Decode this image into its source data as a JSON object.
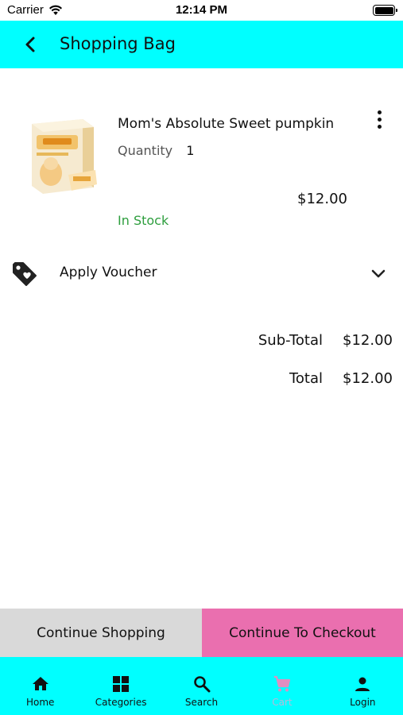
{
  "status_bar": {
    "carrier": "Carrier",
    "time": "12:14 PM"
  },
  "header": {
    "title": "Shopping Bag"
  },
  "cart_item": {
    "name": "Mom's Absolute Sweet pumpkin",
    "quantity_label": "Quantity",
    "quantity": "1",
    "price": "$12.00",
    "stock_status": "In Stock",
    "image_icon": "product-box-image"
  },
  "voucher": {
    "label": "Apply Voucher",
    "icon": "tag-icon",
    "chevron": "chevron-down-icon"
  },
  "totals": {
    "subtotal_label": "Sub-Total",
    "subtotal_value": "$12.00",
    "total_label": "Total",
    "total_value": "$12.00"
  },
  "actions": {
    "continue_label": "Continue Shopping",
    "checkout_label": "Continue To Checkout"
  },
  "bottom_nav": {
    "items": [
      {
        "label": "Home",
        "icon": "home-icon"
      },
      {
        "label": "Categories",
        "icon": "grid-icon"
      },
      {
        "label": "Search",
        "icon": "search-icon"
      },
      {
        "label": "Cart",
        "icon": "cart-icon"
      },
      {
        "label": "Login",
        "icon": "person-icon"
      }
    ]
  },
  "colors": {
    "header_bg": "#00ffff",
    "checkout_bg": "#ea6faf",
    "continue_bg": "#d9d9d9",
    "in_stock": "#2e9e3e",
    "nav_disabled": "#b8b8d8"
  }
}
